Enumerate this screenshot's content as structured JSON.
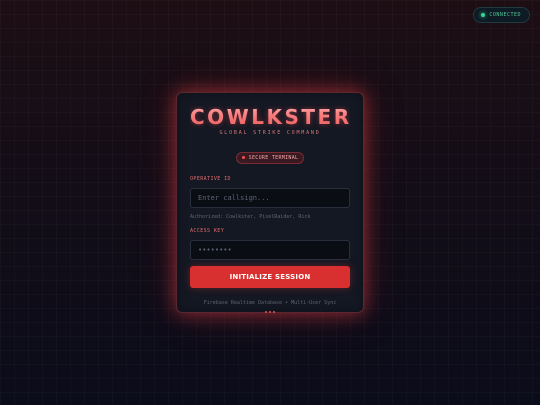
{
  "status": {
    "label": "CONNECTED",
    "color": "#36d399"
  },
  "brand": {
    "logo": "COWLKSTER",
    "subtitle": "GLOBAL STRIKE COMMAND"
  },
  "badge": {
    "label": "SECURE TERMINAL"
  },
  "operative": {
    "label": "OPERATIVE ID",
    "placeholder": "Enter callsign...",
    "hint": "Authorized: Cowlkster, PixelRaider, Rick"
  },
  "access": {
    "label": "ACCESS KEY",
    "value": "••••••••"
  },
  "submit": {
    "label": "INITIALIZE SESSION"
  },
  "footer": {
    "text": "Firebase Realtime Database • Multi-User Sync"
  },
  "colors": {
    "accent": "#d83030",
    "background": "#0b0c1a",
    "card": "#141823"
  }
}
